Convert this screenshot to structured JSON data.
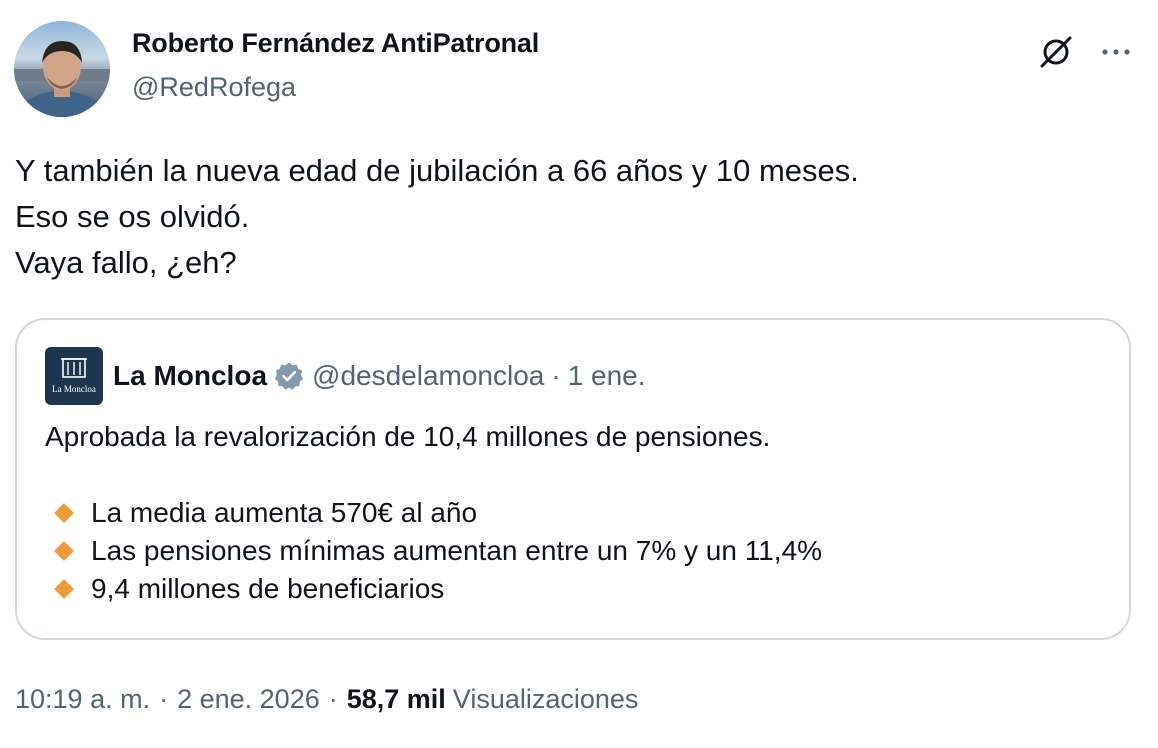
{
  "author": {
    "name": "Roberto Fernández AntiPatronal",
    "handle": "@RedRofega"
  },
  "tweet": {
    "lines": [
      "Y también la nueva edad de jubilación a 66 años y 10 meses.",
      "Eso se os olvidó.",
      "Vaya fallo, ¿eh?"
    ]
  },
  "quote": {
    "avatar_text": "La Moncloa",
    "name": "La Moncloa",
    "handle": "@desdelamoncloa",
    "separator": "·",
    "date": "1 ene.",
    "text": "Aprobada la revalorización de 10,4 millones de pensiones.",
    "bullets": [
      "La media aumenta 570€ al año",
      "Las pensiones mínimas aumentan entre un 7% y un 11,4%",
      "9,4 millones de beneficiarios"
    ]
  },
  "meta": {
    "time": "10:19 a. m.",
    "separator": "·",
    "date": "2 ene. 2026",
    "views_count": "58,7 mil",
    "views_label": "Visualizaciones"
  },
  "icons": {
    "grok": "grok-icon",
    "more": "more-dots-icon",
    "verified": "verified-badge-icon",
    "bullet": "orange-diamond-icon"
  },
  "colors": {
    "text": "#0f1419",
    "secondary": "#536471",
    "border": "#cfd9de",
    "bullet": "#f09a37",
    "moncloa_avatar": "#1e3550"
  }
}
